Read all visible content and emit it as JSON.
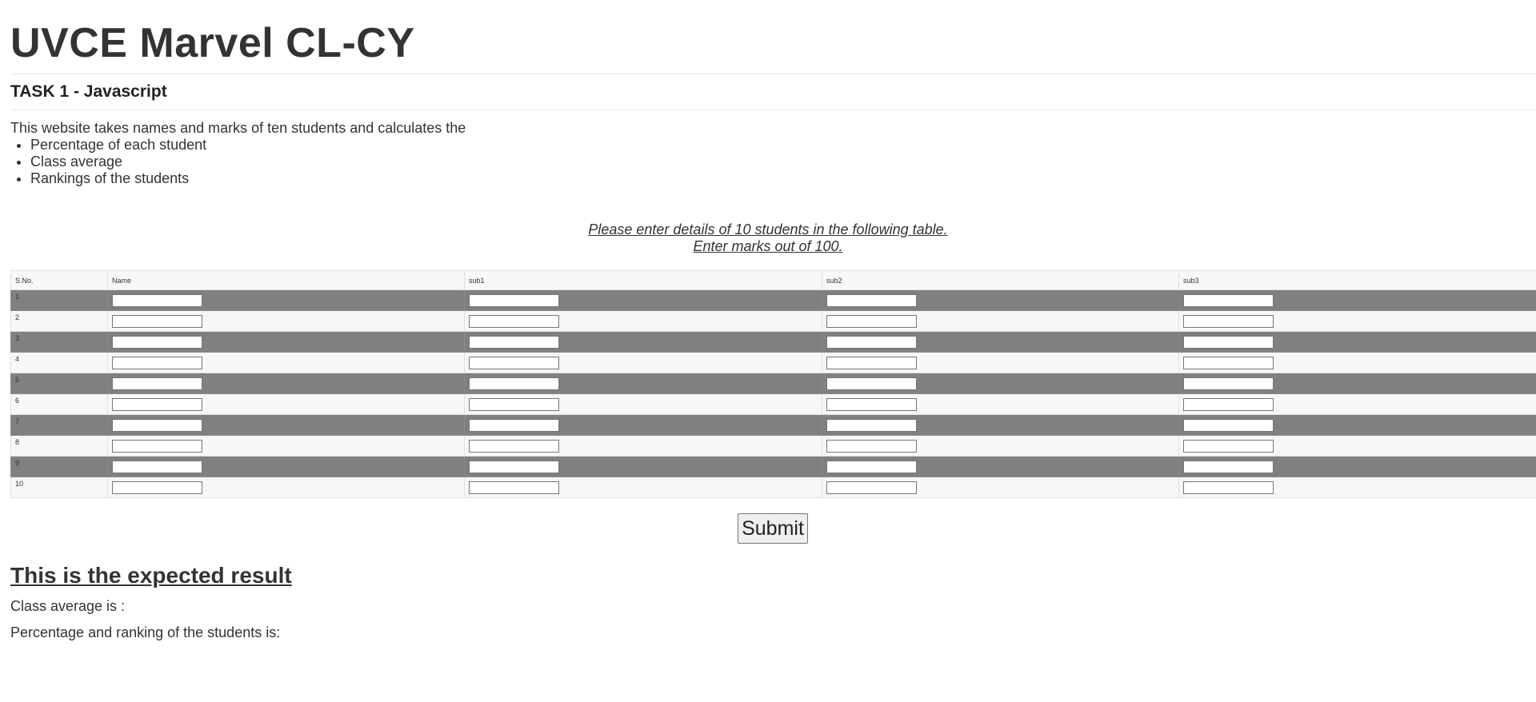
{
  "header": {
    "title": "UVCE Marvel CL-CY",
    "task": "TASK 1 - Javascript"
  },
  "intro": {
    "text": "This website takes names and marks of ten students and calculates the",
    "bullets": [
      "Percentage of each student",
      "Class average",
      "Rankings of the students"
    ]
  },
  "instructions": {
    "line1": "Please enter details of 10 students in the following table.",
    "line2": "Enter marks out of 100."
  },
  "table": {
    "columns": [
      "S.No.",
      "Name",
      "sub1",
      "sub2",
      "sub3"
    ],
    "rows": [
      {
        "sno": "1",
        "name": "",
        "sub1": "",
        "sub2": "",
        "sub3": ""
      },
      {
        "sno": "2",
        "name": "",
        "sub1": "",
        "sub2": "",
        "sub3": ""
      },
      {
        "sno": "3",
        "name": "",
        "sub1": "",
        "sub2": "",
        "sub3": ""
      },
      {
        "sno": "4",
        "name": "",
        "sub1": "",
        "sub2": "",
        "sub3": ""
      },
      {
        "sno": "5",
        "name": "",
        "sub1": "",
        "sub2": "",
        "sub3": ""
      },
      {
        "sno": "6",
        "name": "",
        "sub1": "",
        "sub2": "",
        "sub3": ""
      },
      {
        "sno": "7",
        "name": "",
        "sub1": "",
        "sub2": "",
        "sub3": ""
      },
      {
        "sno": "8",
        "name": "",
        "sub1": "",
        "sub2": "",
        "sub3": ""
      },
      {
        "sno": "9",
        "name": "",
        "sub1": "",
        "sub2": "",
        "sub3": ""
      },
      {
        "sno": "10",
        "name": "",
        "sub1": "",
        "sub2": "",
        "sub3": ""
      }
    ]
  },
  "form": {
    "submit_label": "Submit"
  },
  "result": {
    "title": "This is the expected result",
    "average_label": "Class average is :",
    "ranking_label": "Percentage and ranking of the students is:"
  },
  "colors": {
    "odd_row": "#808080",
    "even_row": "#f7f7f7",
    "text": "#333333"
  }
}
